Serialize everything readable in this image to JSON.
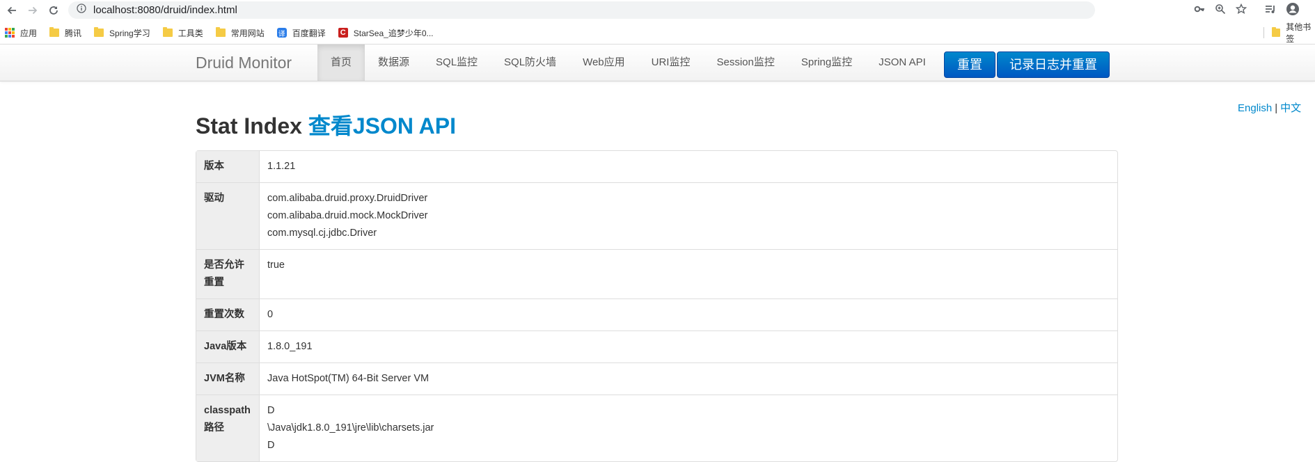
{
  "browser": {
    "url": "localhost:8080/druid/index.html",
    "bookmarks": [
      {
        "label": "应用",
        "icon": "apps-grid-icon"
      },
      {
        "label": "腾讯",
        "icon": "folder-icon"
      },
      {
        "label": "Spring学习",
        "icon": "folder-icon"
      },
      {
        "label": "工具类",
        "icon": "folder-icon"
      },
      {
        "label": "常用网站",
        "icon": "folder-icon"
      },
      {
        "label": "百度翻译",
        "icon": "baidu-fanyi-icon"
      },
      {
        "label": "StarSea_追梦少年0...",
        "icon": "csdn-icon"
      }
    ],
    "other_bookmarks": "其他书签",
    "fanyi_glyph": "译",
    "csdn_glyph": "C"
  },
  "navbar": {
    "brand": "Druid Monitor",
    "items": [
      "首页",
      "数据源",
      "SQL监控",
      "SQL防火墙",
      "Web应用",
      "URI监控",
      "Session监控",
      "Spring监控",
      "JSON API"
    ],
    "reset_button": "重置",
    "log_reset_button": "记录日志并重置"
  },
  "lang": {
    "english": "English",
    "separator": "|",
    "chinese": "中文"
  },
  "page": {
    "title": "Stat Index",
    "title_link": "查看JSON API"
  },
  "stat_rows": [
    {
      "key": "版本",
      "values": [
        "1.1.21"
      ]
    },
    {
      "key": "驱动",
      "values": [
        "com.alibaba.druid.proxy.DruidDriver",
        "com.alibaba.druid.mock.MockDriver",
        "com.mysql.cj.jdbc.Driver"
      ]
    },
    {
      "key": "是否允许重置",
      "values": [
        "true"
      ]
    },
    {
      "key": "重置次数",
      "values": [
        "0"
      ]
    },
    {
      "key": "Java版本",
      "values": [
        "1.8.0_191"
      ]
    },
    {
      "key": "JVM名称",
      "values": [
        "Java HotSpot(TM) 64-Bit Server VM"
      ]
    },
    {
      "key": "classpath路径",
      "values": [
        "D",
        "\\Java\\jdk1.8.0_191\\jre\\lib\\charsets.jar",
        "D"
      ]
    }
  ],
  "colors": {
    "link": "#0088cc",
    "primary_button": "#0066cc",
    "table_key_bg": "#eeeeee"
  }
}
